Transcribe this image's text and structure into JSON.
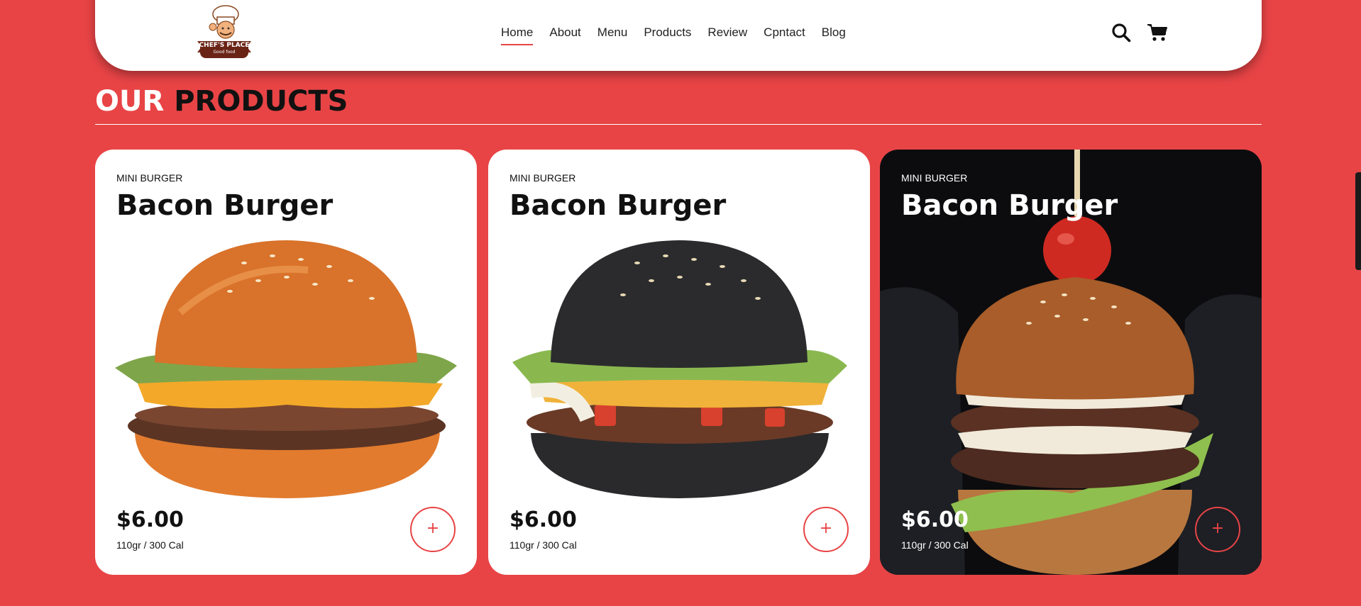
{
  "brand": {
    "name": "CHEF'S PLACE",
    "tagline": "Good food"
  },
  "nav": {
    "links": [
      "Home",
      "About",
      "Menu",
      "Products",
      "Review",
      "Cpntact",
      "Blog"
    ],
    "active": "Home",
    "icons": [
      "search-icon",
      "cart-icon"
    ]
  },
  "section": {
    "title_part1": "OUR",
    "title_part2": "PRODUCTS"
  },
  "products": [
    {
      "category": "MINI BURGER",
      "name": "Bacon Burger",
      "price": "$6.00",
      "meta": "110gr / 300 Cal",
      "add_label": "+",
      "theme": "light"
    },
    {
      "category": "MINI BURGER",
      "name": "Bacon Burger",
      "price": "$6.00",
      "meta": "110gr / 300 Cal",
      "add_label": "+",
      "theme": "light"
    },
    {
      "category": "MINI BURGER",
      "name": "Bacon Burger",
      "price": "$6.00",
      "meta": "110gr / 300 Cal",
      "add_label": "+",
      "theme": "dark"
    }
  ],
  "colors": {
    "accent": "#e84446",
    "dark_card": "#0c0c0e",
    "text": "#111111"
  }
}
